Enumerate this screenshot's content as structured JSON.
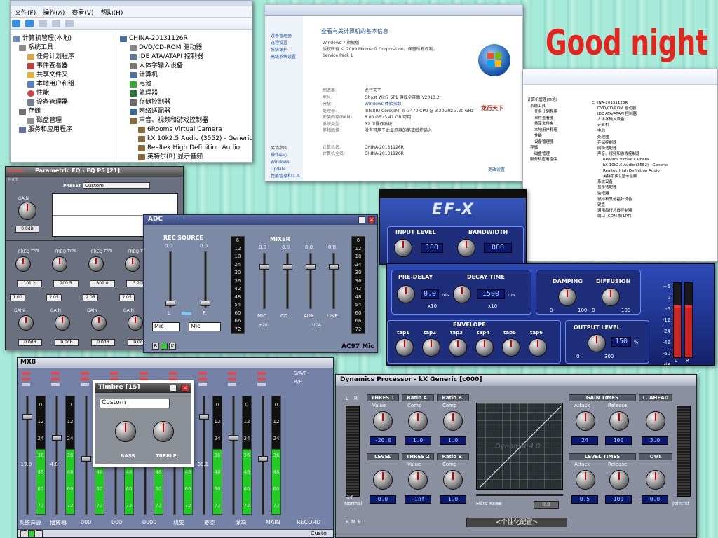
{
  "devmgr1": {
    "menu": [
      "文件(F)",
      "操作(A)",
      "查看(V)",
      "帮助(H)"
    ],
    "left_tree": [
      "计算机管理(本地)",
      "系统工具",
      "任务计划程序",
      "事件查看器",
      "共享文件夹",
      "本地用户和组",
      "性能",
      "设备管理器",
      "存储",
      "磁盘管理",
      "服务和应用程序"
    ],
    "root": "CHINA-20131126R",
    "devices": [
      "DVD/CD-ROM 驱动器",
      "IDE ATA/ATAPI 控制器",
      "人体学输入设备",
      "计算机",
      "电池",
      "处理器",
      "存储控制器",
      "网络适配器",
      "声音、视频和游戏控制器",
      "6Rooms Virtual Camera",
      "kX 10k2.5 Audio (3552) - Generic",
      "Realtek High Definition Audio",
      "英特尔(R) 显示音频"
    ]
  },
  "sysinfo": {
    "heading": "查看有关计算机的基本信息",
    "edition": "Windows 7 旗舰版",
    "copyright": "版权所有 © 2009 Microsoft Corporation。保留所有权利。",
    "sp": "Service Pack 1",
    "left_links": [
      "设备管理器",
      "远程设置",
      "系统保护",
      "高级系统设置"
    ],
    "see_also": [
      "另请参阅",
      "操作中心",
      "Windows Update",
      "性能信息和工具"
    ],
    "rows": [
      [
        "制造商:",
        "龙行天下"
      ],
      [
        "型号:",
        "Ghost Win7 SP1 旗舰全能版 V2013.2"
      ],
      [
        "分级:",
        "Windows 体验指数"
      ],
      [
        "处理器:",
        "Intel(R) Core(TM) i5-3470 CPU @ 3.20GHz   3.20 GHz"
      ],
      [
        "安装内存(RAM):",
        "8.00 GB (3.41 GB 可用)"
      ],
      [
        "系统类型:",
        "32 位操作系统"
      ],
      [
        "笔和触摸:",
        "没有可用于此显示器的笔或触控输入"
      ],
      [
        "计算机名:",
        "CHINA-20131126R"
      ],
      [
        "计算机全名:",
        "CHINA-20131126R"
      ]
    ],
    "brand": "龙行天下",
    "change_settings": "更改设置"
  },
  "devmgr2": {
    "root": "CHINA-20131126R",
    "left_tree": [
      "计算机管理(本地)",
      "系统工具",
      "任务计划程序",
      "事件查看器",
      "共享文件夹",
      "本地用户和组",
      "性能",
      "设备管理器",
      "存储",
      "磁盘管理",
      "服务和应用程序"
    ],
    "devices": [
      "DVD/CD-ROM 驱动器",
      "IDE ATA/ATAPI 控制器",
      "人体学输入设备",
      "计算机",
      "电池",
      "处理器",
      "存储控制器",
      "网络适配器",
      "声音、视频和游戏控制器",
      "6Rooms Virtual Camera",
      "kX 10k2.5 Audio (3552) - Generic",
      "Realtek High Definition Audio",
      "英特尔(R) 显示音频",
      "系统设备",
      "显示适配器",
      "监视器",
      "鼠标和其他指针设备",
      "键盘",
      "通用串行总线控制器",
      "端口 (COM 和 LPT)"
    ]
  },
  "goodnight": "Good night",
  "peq": {
    "title": "Parametric EQ - EQ P5 [21]",
    "bypass": "BYPASS",
    "mute": "MUTE",
    "preset_label": "PRESET",
    "preset": "Custom",
    "gain_label": "GAIN",
    "gain_val": "0.0dB",
    "freq_label": "FREQ",
    "type_label": "TYPE",
    "freqs": [
      "101.2",
      "200.5",
      "801.0",
      "3.20k"
    ],
    "qs": [
      "1.00",
      "2.05",
      "2.05",
      "2.05"
    ],
    "band_gains": [
      "0.0dB",
      "0.0dB",
      "0.0dB",
      "0.0dB"
    ]
  },
  "adc": {
    "title": "ADC",
    "rec_source": "REC SOURCE",
    "mixer": "MIXER",
    "top_vals": [
      "0.0",
      "0.0",
      "0.0",
      "0.0",
      "0.0",
      "0.0"
    ],
    "ch_labels": [
      "MIC",
      "CD",
      "AUX",
      "LINE"
    ],
    "sub": [
      "+20",
      "UDA"
    ],
    "lr": [
      "L",
      "R"
    ],
    "sel1": "Mic",
    "sel2": "Mic",
    "scale": [
      "6",
      "12",
      "18",
      "24",
      "30",
      "36",
      "42",
      "48",
      "54",
      "60",
      "66",
      "72"
    ],
    "footer": "AC97 Mic",
    "rgk": [
      "R",
      "G",
      "K"
    ]
  },
  "efx": {
    "title": "EF-X",
    "input_level": "INPUT LEVEL",
    "input_val": "100",
    "bandwidth": "BANDWIDTH",
    "bandwidth_val": "000",
    "pre_delay": "PRE-DELAY",
    "pre_val": "0.0",
    "decay_time": "DECAY TIME",
    "decay_val": "1500",
    "ms": "ms",
    "x10": "x10",
    "damping": "DAMPING",
    "diffusion": "DIFFUSION",
    "d0": "0",
    "d100": "100",
    "envelope": "ENVELOPE",
    "taps": [
      "tap1",
      "tap2",
      "tap3",
      "tap4",
      "tap5",
      "tap6"
    ],
    "output_level": "OUTPUT LEVEL",
    "output_val": "150",
    "pct": "%",
    "o0": "0",
    "o300": "300",
    "db_scale": [
      "+6",
      "0",
      "-6",
      "-12",
      "-24",
      "-42",
      "-60",
      "dB"
    ],
    "lr": [
      "L",
      "R"
    ]
  },
  "mx8": {
    "title": "MX8",
    "btns": [
      "S/A/P",
      "R/F"
    ],
    "values": [
      "-19.0",
      "-4.8",
      "",
      "",
      "",
      "",
      "-30.1",
      "",
      ""
    ],
    "labels": [
      "系统音源",
      "播放器",
      "000",
      "000",
      "0000",
      "机架",
      "麦克",
      "混响",
      "MAIN",
      "RECORD"
    ],
    "scale": [
      "0",
      "12",
      "24",
      "36",
      "48",
      "60",
      "72"
    ],
    "custom": "Custo"
  },
  "timbre": {
    "title": "Timbre [15]",
    "preset": "Custom",
    "bass": "BASS",
    "treble": "TREBLE"
  },
  "dyn": {
    "title": "Dynamics Processor - kX Generic [c000]",
    "lr": [
      "L",
      "R"
    ],
    "groups": [
      {
        "name": "THRES 1",
        "sub": "Value",
        "val": "-20.0"
      },
      {
        "name": "Ratio A.",
        "sub": "Comp",
        "val": "1.0"
      },
      {
        "name": "Ratio B.",
        "sub": "Comp",
        "val": "1.0"
      },
      {
        "name": "LEVEL",
        "sub": "",
        "val": "0.0"
      },
      {
        "name": "THRES 2",
        "sub": "Value",
        "val": "-inf"
      },
      {
        "name": "Ratio B.",
        "sub": "Comp",
        "val": "1.0"
      }
    ],
    "right_groups": [
      {
        "name": "GAIN TIMES",
        "subs": [
          "Attack",
          "Release"
        ],
        "vals": [
          "24",
          "100"
        ]
      },
      {
        "name": "L. AHEAD",
        "subs": [
          ""
        ],
        "vals": [
          "3.0"
        ]
      },
      {
        "name": "LEVEL TIMES",
        "subs": [
          "Attack",
          "Release"
        ],
        "vals": [
          "0.5",
          "100"
        ]
      },
      {
        "name": "OUT",
        "subs": [
          ""
        ],
        "vals": [
          "0.0"
        ]
      }
    ],
    "graph_label": "DynamiX 4.0",
    "normal": "Normal",
    "hard_knee": "Hard Knee",
    "joint": "Joint st",
    "inf": "-inf",
    "zero": "0.0",
    "footer": "<个性化配置>",
    "rmb": [
      "R",
      "M",
      "B"
    ]
  }
}
